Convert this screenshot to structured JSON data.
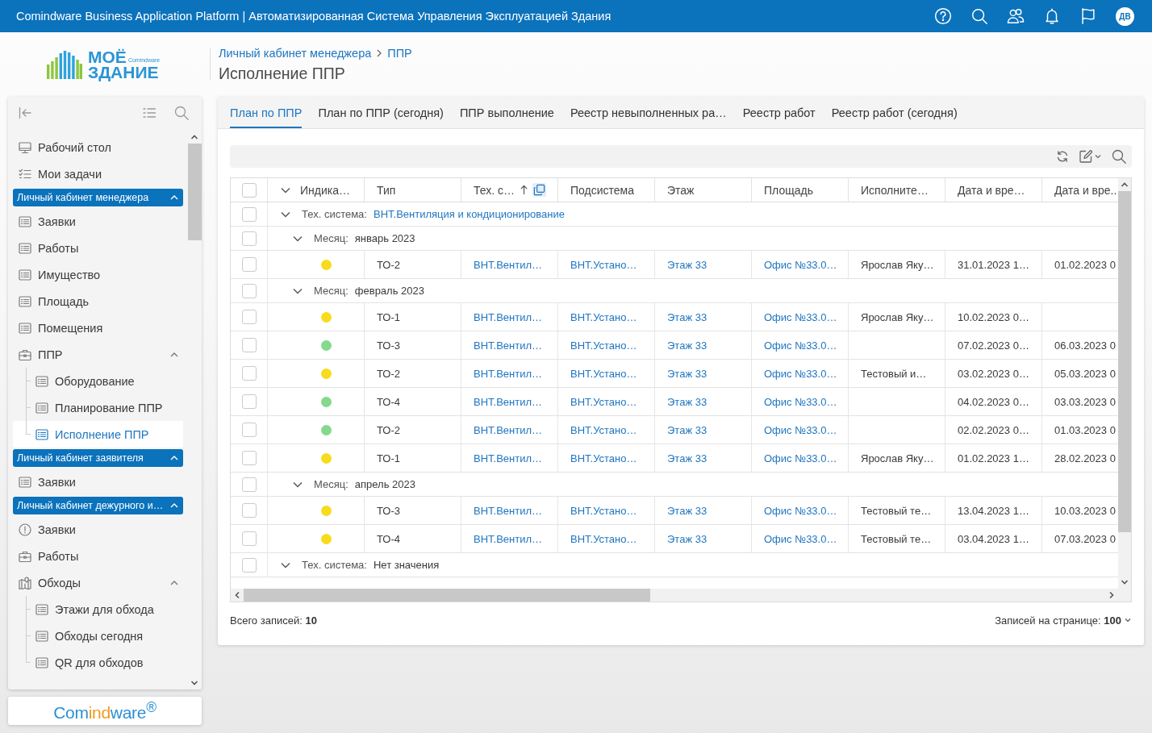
{
  "top_bar": {
    "title": "Comindware Business Application Platform | Автоматизированная Система Управления Эксплуатацией Здания",
    "avatar_initials": "ДВ"
  },
  "logo": {
    "line_1": "МОЁ",
    "line_2": "ЗДАНИЕ",
    "brand": "Comindware"
  },
  "breadcrumb": {
    "links": [
      "Личный кабинет менеджера",
      "ППР"
    ],
    "title": "Исполнение ППР"
  },
  "sidebar": {
    "items": [
      {
        "kind": "desktop",
        "label": "Рабочий стол",
        "selected": false
      },
      {
        "kind": "tasks",
        "label": "Мои задачи",
        "selected": false
      },
      {
        "kind": "section",
        "label": "Личный кабинет менеджера",
        "expanded": true,
        "children": [
          {
            "kind": "list",
            "label": "Заявки",
            "selected": false
          },
          {
            "kind": "list",
            "label": "Работы",
            "selected": false
          },
          {
            "kind": "list",
            "label": "Имущество",
            "selected": false
          },
          {
            "kind": "list",
            "label": "Площадь",
            "selected": false
          },
          {
            "kind": "list",
            "label": "Помещения",
            "selected": false
          },
          {
            "kind": "toolbox",
            "label": "ППР",
            "selected": false,
            "expanded": true,
            "children": [
              {
                "kind": "list",
                "label": "Оборудование",
                "selected": false
              },
              {
                "kind": "list",
                "label": "Планирование ППР",
                "selected": false
              },
              {
                "kind": "list",
                "label": "Исполнение ППР",
                "selected": true
              }
            ]
          }
        ]
      },
      {
        "kind": "section",
        "label": "Личный кабинет заявителя",
        "expanded": true,
        "children": [
          {
            "kind": "list",
            "label": "Заявки",
            "selected": false
          }
        ]
      },
      {
        "kind": "section",
        "label": "Личный кабинет дежурного и…",
        "expanded": true,
        "children": [
          {
            "kind": "alert",
            "label": "Заявки",
            "selected": false
          },
          {
            "kind": "toolbox",
            "label": "Работы",
            "selected": false
          },
          {
            "kind": "map",
            "label": "Обходы",
            "selected": false,
            "expanded": true,
            "children": [
              {
                "kind": "list",
                "label": "Этажи для обхода",
                "selected": false
              },
              {
                "kind": "list",
                "label": "Обходы сегодня",
                "selected": false
              },
              {
                "kind": "list",
                "label": "QR для обходов",
                "selected": false
              }
            ]
          }
        ]
      }
    ]
  },
  "brand_footer": {
    "segments": [
      {
        "text": "Com",
        "accent": false
      },
      {
        "text": "ind",
        "accent": true
      },
      {
        "text": "ware$^{®}$",
        "accent": false
      }
    ]
  },
  "tabs": [
    {
      "label": "План по ППР",
      "selected": true
    },
    {
      "label": "План по ППР (сегодня)",
      "selected": false
    },
    {
      "label": "ППР выполнение",
      "selected": false
    },
    {
      "label": "Реестр невыполненных ра…",
      "selected": false
    },
    {
      "label": "Реестр работ",
      "selected": false
    },
    {
      "label": "Реестр работ (сегодня)",
      "selected": false
    }
  ],
  "table": {
    "select_all_checked": false,
    "columns": [
      {
        "label": "Индика…",
        "kind": "indicator",
        "sorted": false,
        "grouped": false
      },
      {
        "label": "Тип",
        "kind": "text",
        "sorted": false,
        "grouped": false
      },
      {
        "label": "Тех. с…",
        "kind": "link",
        "sorted": true,
        "grouped": true
      },
      {
        "label": "Подсистема",
        "kind": "link",
        "sorted": false,
        "grouped": false
      },
      {
        "label": "Этаж",
        "kind": "link",
        "sorted": false,
        "grouped": false
      },
      {
        "label": "Площадь",
        "kind": "link",
        "sorted": false,
        "grouped": false
      },
      {
        "label": "Исполните…",
        "kind": "text",
        "sorted": false,
        "grouped": false
      },
      {
        "label": "Дата и вре…",
        "kind": "text",
        "sorted": false,
        "grouped": false
      },
      {
        "label": "Дата и вре..",
        "kind": "text",
        "sorted": false,
        "grouped": false
      }
    ],
    "groups": [
      {
        "label": "Тех. система:",
        "value": "ВНТ.Вентиляция и кондиционирование",
        "link": true,
        "checked": false,
        "expanded": true,
        "groups": [
          {
            "label": "Месяц:",
            "value": "январь 2023",
            "link": false,
            "checked": false,
            "expanded": true,
            "rows": [
              {
                "checked": false,
                "color": "#f6dc1c",
                "cells": [
                  "ТО-2",
                  "ВНТ.Вентил…",
                  "ВНТ.Устано…",
                  "Этаж 33",
                  "Офис №33.0…",
                  "Ярослав Яку…",
                  "31.01.2023 1…",
                  "01.02.2023 0"
                ]
              }
            ]
          },
          {
            "label": "Месяц:",
            "value": "февраль 2023",
            "link": false,
            "checked": false,
            "expanded": true,
            "rows": [
              {
                "checked": false,
                "color": "#f6dc1c",
                "cells": [
                  "ТО-1",
                  "ВНТ.Вентил…",
                  "ВНТ.Устано…",
                  "Этаж 33",
                  "Офис №33.0…",
                  "Ярослав Яку…",
                  "10.02.2023 0…",
                  null
                ]
              },
              {
                "checked": false,
                "color": "#84d98c",
                "cells": [
                  "ТО-3",
                  "ВНТ.Вентил…",
                  "ВНТ.Устано…",
                  "Этаж 33",
                  "Офис №33.0…",
                  null,
                  "07.02.2023 0…",
                  "06.03.2023 0"
                ]
              },
              {
                "checked": false,
                "color": "#f6dc1c",
                "cells": [
                  "ТО-2",
                  "ВНТ.Вентил…",
                  "ВНТ.Устано…",
                  "Этаж 33",
                  "Офис №33.0…",
                  "Тестовый и…",
                  "03.02.2023 0…",
                  "05.03.2023 0"
                ]
              },
              {
                "checked": false,
                "color": "#84d98c",
                "cells": [
                  "ТО-4",
                  "ВНТ.Вентил…",
                  "ВНТ.Устано…",
                  "Этаж 33",
                  "Офис №33.0…",
                  null,
                  "04.02.2023 0…",
                  "03.03.2023 0"
                ]
              },
              {
                "checked": false,
                "color": "#84d98c",
                "cells": [
                  "ТО-2",
                  "ВНТ.Вентил…",
                  "ВНТ.Устано…",
                  "Этаж 33",
                  "Офис №33.0…",
                  null,
                  "02.02.2023 0…",
                  "01.03.2023 0"
                ]
              },
              {
                "checked": false,
                "color": "#f6dc1c",
                "cells": [
                  "ТО-1",
                  "ВНТ.Вентил…",
                  "ВНТ.Устано…",
                  "Этаж 33",
                  "Офис №33.0…",
                  "Ярослав Яку…",
                  "01.02.2023 1…",
                  "28.02.2023 0"
                ]
              }
            ]
          },
          {
            "label": "Месяц:",
            "value": "апрель 2023",
            "link": false,
            "checked": false,
            "expanded": true,
            "rows": [
              {
                "checked": false,
                "color": "#f6dc1c",
                "cells": [
                  "ТО-3",
                  "ВНТ.Вентил…",
                  "ВНТ.Устано…",
                  "Этаж 33",
                  "Офис №33.0…",
                  "Тестовый те…",
                  "13.04.2023 1…",
                  "10.03.2023 0"
                ]
              },
              {
                "checked": false,
                "color": "#f6dc1c",
                "cells": [
                  "ТО-4",
                  "ВНТ.Вентил…",
                  "ВНТ.Устано…",
                  "Этаж 33",
                  "Офис №33.0…",
                  "Тестовый те…",
                  "03.04.2023 1…",
                  "07.03.2023 0"
                ]
              }
            ]
          }
        ]
      },
      {
        "label": "Тех. система:",
        "value": "Нет значения",
        "link": false,
        "checked": false,
        "expanded": true
      }
    ]
  },
  "footer": {
    "total": "Всего записей: **10**",
    "page_size": "Записей на странице: **100**"
  }
}
